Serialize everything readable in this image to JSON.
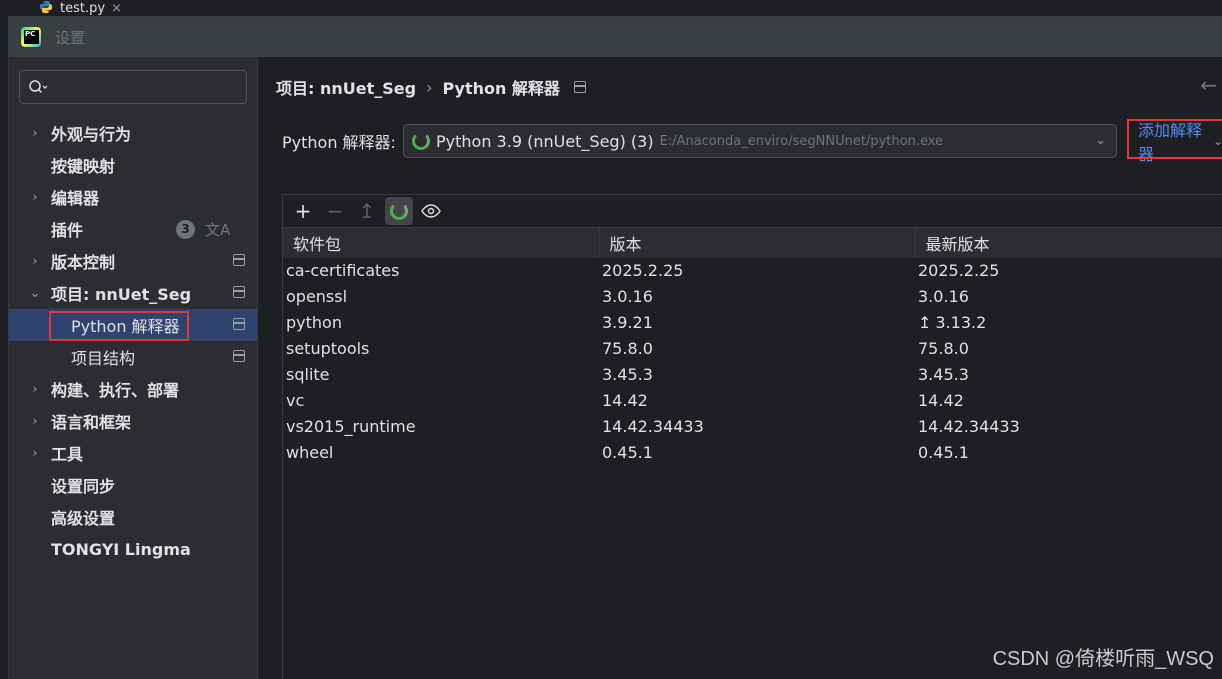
{
  "editor": {
    "file_tab": "test.py",
    "close_glyph": "×"
  },
  "dialog": {
    "title": "设置"
  },
  "sidebar": {
    "items": [
      {
        "label": "外观与行为",
        "arrow": "›"
      },
      {
        "label": "按键映射",
        "arrow": ""
      },
      {
        "label": "编辑器",
        "arrow": "›"
      },
      {
        "label": "插件",
        "arrow": "",
        "badge": "3"
      },
      {
        "label": "版本控制",
        "arrow": "›"
      },
      {
        "label": "项目: nnUet_Seg",
        "arrow": "⌄"
      },
      {
        "label": "Python 解释器"
      },
      {
        "label": "项目结构"
      },
      {
        "label": "构建、执行、部署",
        "arrow": "›"
      },
      {
        "label": "语言和框架",
        "arrow": "›"
      },
      {
        "label": "工具",
        "arrow": "›"
      },
      {
        "label": "设置同步",
        "arrow": ""
      },
      {
        "label": "高级设置",
        "arrow": ""
      },
      {
        "label": "TONGYI Lingma",
        "arrow": ""
      }
    ]
  },
  "breadcrumb": {
    "project": "项目: nnUet_Seg",
    "sep": "›",
    "page": "Python 解释器"
  },
  "interpreter": {
    "label": "Python 解释器:",
    "name": "Python 3.9 (nnUet_Seg) (3)",
    "path": "E:/Anaconda_enviro/segNNUnet/python.exe",
    "add_label": "添加解释器"
  },
  "packages": {
    "headers": [
      "软件包",
      "版本",
      "最新版本"
    ],
    "rows": [
      {
        "name": "ca-certificates",
        "version": "2025.2.25",
        "latest": "2025.2.25",
        "upgrade": false
      },
      {
        "name": "openssl",
        "version": "3.0.16",
        "latest": "3.0.16",
        "upgrade": false
      },
      {
        "name": "python",
        "version": "3.9.21",
        "latest": "3.13.2",
        "upgrade": true
      },
      {
        "name": "setuptools",
        "version": "75.8.0",
        "latest": "75.8.0",
        "upgrade": false
      },
      {
        "name": "sqlite",
        "version": "3.45.3",
        "latest": "3.45.3",
        "upgrade": false
      },
      {
        "name": "vc",
        "version": "14.42",
        "latest": "14.42",
        "upgrade": false
      },
      {
        "name": "vs2015_runtime",
        "version": "14.42.34433",
        "latest": "14.42.34433",
        "upgrade": false
      },
      {
        "name": "wheel",
        "version": "0.45.1",
        "latest": "0.45.1",
        "upgrade": false
      }
    ]
  },
  "watermark": "CSDN @倚楼听雨_WSQ",
  "colors": {
    "accent": "#548af7",
    "selection": "#2e436e",
    "highlight_box": "#e5353a"
  }
}
